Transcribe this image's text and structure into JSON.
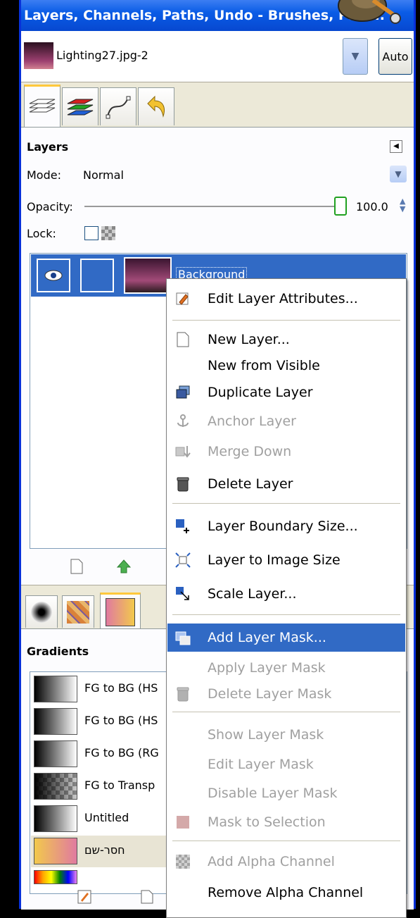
{
  "window": {
    "title": "Layers, Channels, Paths, Undo - Brushes, Patt..."
  },
  "image_selector": {
    "name": "Lighting27.jpg-2",
    "auto_label": "Auto"
  },
  "dock_tabs": [
    "layers-tab",
    "channels-tab",
    "paths-tab",
    "undo-tab"
  ],
  "layers": {
    "heading": "Layers",
    "mode_label": "Mode:",
    "mode_value": "Normal",
    "opacity_label": "Opacity:",
    "opacity_value": "100.0",
    "lock_label": "Lock:",
    "rows": [
      {
        "name": "Background",
        "visible": true,
        "selected": true
      }
    ]
  },
  "gradients": {
    "heading": "Gradients",
    "items": [
      {
        "name": "FG to BG (HS",
        "selected": false
      },
      {
        "name": "FG to BG (HS",
        "selected": false
      },
      {
        "name": "FG to BG (RG",
        "selected": false
      },
      {
        "name": "FG to Transp",
        "selected": false
      },
      {
        "name": "Untitled",
        "selected": false
      },
      {
        "name": "חסר-שם",
        "selected": true
      }
    ]
  },
  "context_menu": {
    "items": [
      {
        "label": "Edit Layer Attributes...",
        "enabled": true,
        "highlighted": false,
        "icon": "edit-icon"
      },
      {
        "label": "New Layer...",
        "enabled": true,
        "highlighted": false,
        "icon": "new-layer-icon"
      },
      {
        "label": "New from Visible",
        "enabled": true,
        "highlighted": false,
        "icon": ""
      },
      {
        "label": "Duplicate Layer",
        "enabled": true,
        "highlighted": false,
        "icon": "duplicate-icon"
      },
      {
        "label": "Anchor Layer",
        "enabled": false,
        "highlighted": false,
        "icon": "anchor-icon"
      },
      {
        "label": "Merge Down",
        "enabled": false,
        "highlighted": false,
        "icon": "merge-down-icon"
      },
      {
        "label": "Delete Layer",
        "enabled": true,
        "highlighted": false,
        "icon": "trash-icon"
      },
      {
        "label": "Layer Boundary Size...",
        "enabled": true,
        "highlighted": false,
        "icon": "boundary-size-icon"
      },
      {
        "label": "Layer to Image Size",
        "enabled": true,
        "highlighted": false,
        "icon": "to-image-size-icon"
      },
      {
        "label": "Scale Layer...",
        "enabled": true,
        "highlighted": false,
        "icon": "scale-icon"
      },
      {
        "label": "Add Layer Mask...",
        "enabled": true,
        "highlighted": true,
        "icon": "add-mask-icon"
      },
      {
        "label": "Apply Layer Mask",
        "enabled": false,
        "highlighted": false,
        "icon": ""
      },
      {
        "label": "Delete Layer Mask",
        "enabled": false,
        "highlighted": false,
        "icon": "trash-icon"
      },
      {
        "label": "Show Layer Mask",
        "enabled": false,
        "highlighted": false,
        "icon": ""
      },
      {
        "label": "Edit Layer Mask",
        "enabled": false,
        "highlighted": false,
        "icon": ""
      },
      {
        "label": "Disable Layer Mask",
        "enabled": false,
        "highlighted": false,
        "icon": ""
      },
      {
        "label": "Mask to Selection",
        "enabled": false,
        "highlighted": false,
        "icon": "mask-selection-icon"
      },
      {
        "label": "Add Alpha Channel",
        "enabled": false,
        "highlighted": false,
        "icon": "alpha-icon"
      },
      {
        "label": "Remove Alpha Channel",
        "enabled": true,
        "highlighted": false,
        "icon": ""
      }
    ]
  },
  "colors": {
    "titlebar": "#0a5ce6",
    "highlight": "#316ac5",
    "tab_accent": "#ffc83c"
  }
}
